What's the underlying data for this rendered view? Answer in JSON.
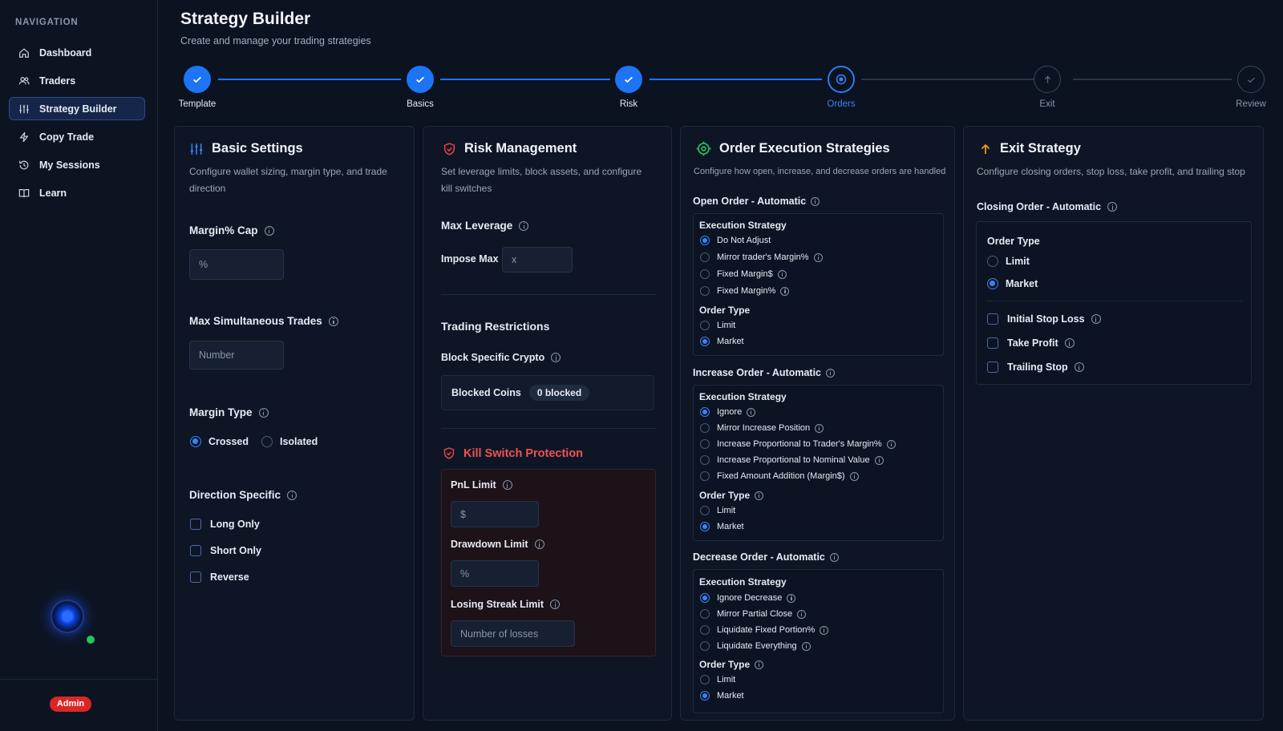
{
  "sidebar": {
    "title": "NAVIGATION",
    "items": [
      {
        "label": "Dashboard",
        "icon": "home-icon"
      },
      {
        "label": "Traders",
        "icon": "users-icon"
      },
      {
        "label": "Strategy Builder",
        "icon": "sliders-icon",
        "active": true
      },
      {
        "label": "Copy Trade",
        "icon": "lightning-icon"
      },
      {
        "label": "My Sessions",
        "icon": "history-icon"
      },
      {
        "label": "Learn",
        "icon": "book-icon"
      }
    ],
    "admin_badge": "Admin"
  },
  "header": {
    "title": "Strategy Builder",
    "subtitle": "Create and manage your trading strategies"
  },
  "stepper": {
    "steps": [
      {
        "label": "Template",
        "state": "done"
      },
      {
        "label": "Basics",
        "state": "done"
      },
      {
        "label": "Risk",
        "state": "done"
      },
      {
        "label": "Orders",
        "state": "current"
      },
      {
        "label": "Exit",
        "state": "todo"
      },
      {
        "label": "Review",
        "state": "todo"
      }
    ]
  },
  "basic": {
    "title": "Basic Settings",
    "desc1": "Configure wallet sizing, margin type, and trade",
    "desc2": "direction",
    "margin_cap_label": "Margin% Cap",
    "margin_cap_placeholder": "%",
    "max_trades_label": "Max Simultaneous Trades",
    "max_trades_placeholder": "Number",
    "margin_type_label": "Margin Type",
    "margin_type_options": [
      "Crossed",
      "Isolated"
    ],
    "margin_type_selected": "Crossed",
    "direction_label": "Direction Specific",
    "direction_options": [
      "Long Only",
      "Short Only",
      "Reverse"
    ]
  },
  "risk": {
    "title": "Risk Management",
    "desc1": "Set leverage limits, block assets, and configure",
    "desc2": "kill switches",
    "max_leverage_label": "Max Leverage",
    "impose_max_label": "Impose Max",
    "impose_max_placeholder": "x",
    "restrictions_title": "Trading Restrictions",
    "block_label": "Block Specific Crypto",
    "blocked_coins_label": "Blocked Coins",
    "blocked_count": "0 blocked",
    "kill_title": "Kill Switch Protection",
    "pnl_label": "PnL Limit",
    "pnl_placeholder": "$",
    "drawdown_label": "Drawdown Limit",
    "drawdown_placeholder": "%",
    "losing_label": "Losing Streak Limit",
    "losing_placeholder": "Number of losses"
  },
  "orders": {
    "title": "Order Execution Strategies",
    "desc": "Configure how open, increase, and decrease orders are handled",
    "open": {
      "title": "Open Order - Automatic",
      "exec_label": "Execution Strategy",
      "exec_options": [
        "Do Not Adjust",
        "Mirror trader's Margin%",
        "Fixed Margin$",
        "Fixed Margin%"
      ],
      "exec_selected": 0,
      "type_label": "Order Type",
      "type_options": [
        "Limit",
        "Market"
      ],
      "type_selected": 1
    },
    "increase": {
      "title": "Increase Order - Automatic",
      "exec_label": "Execution Strategy",
      "exec_options": [
        "Ignore",
        "Mirror Increase Position",
        "Increase Proportional to Trader's Margin%",
        "Increase Proportional to Nominal Value",
        "Fixed Amount Addition (Margin$)"
      ],
      "exec_selected": 0,
      "type_label": "Order Type",
      "type_options": [
        "Limit",
        "Market"
      ],
      "type_selected": 1
    },
    "decrease": {
      "title": "Decrease Order - Automatic",
      "exec_label": "Execution Strategy",
      "exec_options": [
        "Ignore Decrease",
        "Mirror Partial Close",
        "Liquidate Fixed Portion%",
        "Liquidate Everything"
      ],
      "exec_selected": 0,
      "type_label": "Order Type",
      "type_options": [
        "Limit",
        "Market"
      ],
      "type_selected": 1
    }
  },
  "exit": {
    "title": "Exit Strategy",
    "desc": "Configure closing orders, stop loss, take profit, and trailing stop",
    "closing_title": "Closing Order - Automatic",
    "type_label": "Order Type",
    "type_options": [
      "Limit",
      "Market"
    ],
    "type_selected": 1,
    "checks": [
      "Initial Stop Loss",
      "Take Profit",
      "Trailing Stop"
    ]
  },
  "colors": {
    "accent": "#3b82f6",
    "danger": "#ef4444",
    "success": "#22c55e",
    "warning": "#f59e0b"
  }
}
